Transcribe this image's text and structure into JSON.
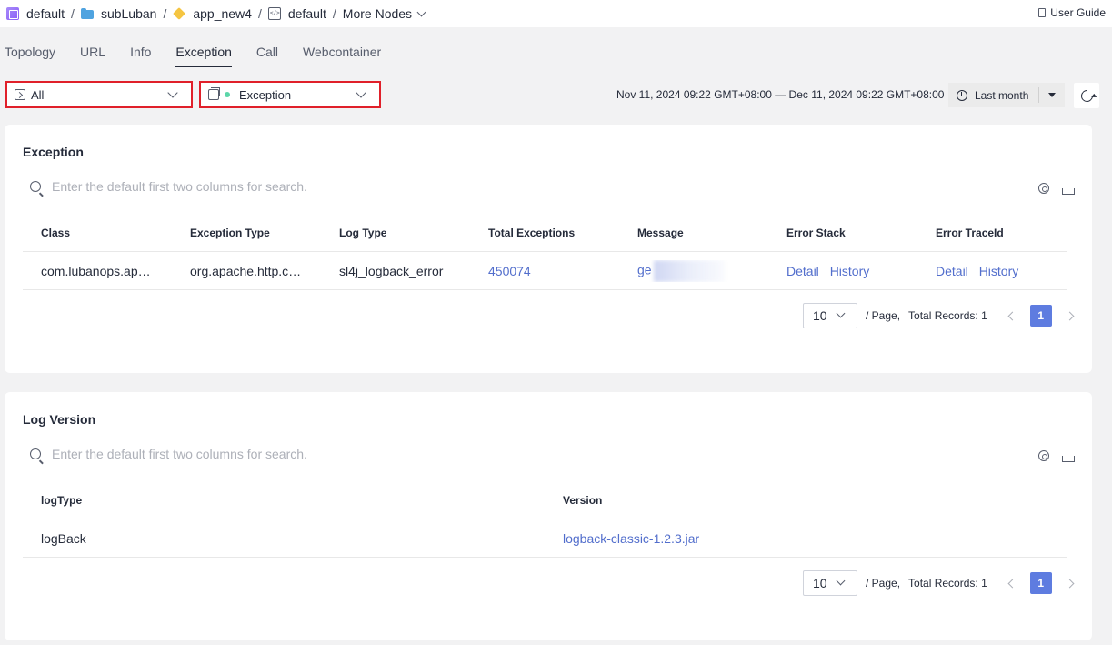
{
  "breadcrumb": {
    "items": [
      "default",
      "subLuban",
      "app_new4",
      "default"
    ],
    "separator": "/",
    "more": "More Nodes"
  },
  "user_guide": "User Guide",
  "tabs": [
    "Topology",
    "URL",
    "Info",
    "Exception",
    "Call",
    "Webcontainer"
  ],
  "active_tab": "Exception",
  "filters": {
    "scope_value": "All",
    "type_value": "Exception"
  },
  "time": {
    "range": "Nov 11, 2024 09:22 GMT+08:00 — Dec 11, 2024 09:22 GMT+08:00",
    "preset": "Last month"
  },
  "exception_card": {
    "title": "Exception",
    "search_placeholder": "Enter the default first two columns for search.",
    "columns": [
      "Class",
      "Exception Type",
      "Log Type",
      "Total Exceptions",
      "Message",
      "Error Stack",
      "Error TraceId"
    ],
    "rows": [
      {
        "class": "com.lubanops.ap…",
        "exception_type": "org.apache.http.c…",
        "log_type": "sl4j_logback_error",
        "total": "450074",
        "message": "ge",
        "stack_detail": "Detail",
        "stack_history": "History",
        "trace_detail": "Detail",
        "trace_history": "History"
      }
    ],
    "pager": {
      "page_size": "10",
      "per_page_label": "/ Page,",
      "total_label": "Total Records: 1",
      "current_page": "1"
    }
  },
  "logversion_card": {
    "title": "Log Version",
    "search_placeholder": "Enter the default first two columns for search.",
    "columns": [
      "logType",
      "Version"
    ],
    "rows": [
      {
        "log_type": "logBack",
        "version": "logback-classic-1.2.3.jar"
      }
    ],
    "pager": {
      "page_size": "10",
      "per_page_label": "/ Page,",
      "total_label": "Total Records: 1",
      "current_page": "1"
    }
  },
  "colors": {
    "link": "#526ecc",
    "highlight_border": "#e0202a",
    "status_dot": "#5cd6a9",
    "page_active": "#5e7ce0"
  }
}
